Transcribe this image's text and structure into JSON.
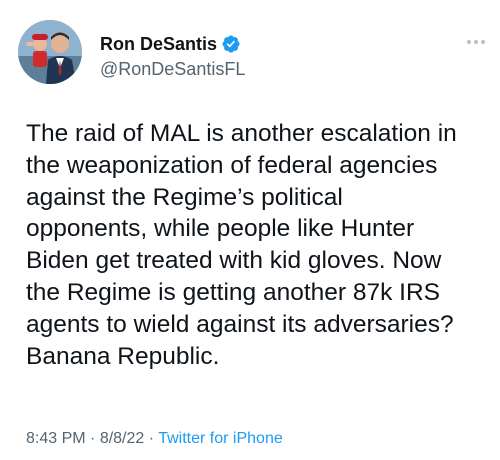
{
  "tweet": {
    "display_name": "Ron DeSantis",
    "handle": "@RonDeSantisFL",
    "verified": true,
    "verified_icon": "verified-badge-icon",
    "more_icon": "more-options-icon",
    "text": "The raid of MAL is another escalation in\nthe weaponization of federal agencies\nagainst the Regime’s political\nopponents, while people like Hunter\nBiden get treated with kid gloves. Now\nthe Regime is getting another 87k IRS\nagents to wield against its adversaries?\nBanana Republic.",
    "time": "8:43 PM",
    "date": "8/8/22",
    "separator": " · ",
    "source": "Twitter for iPhone"
  },
  "colors": {
    "text_primary": "#0f1419",
    "text_secondary": "#536471",
    "accent": "#1d9bf0"
  }
}
